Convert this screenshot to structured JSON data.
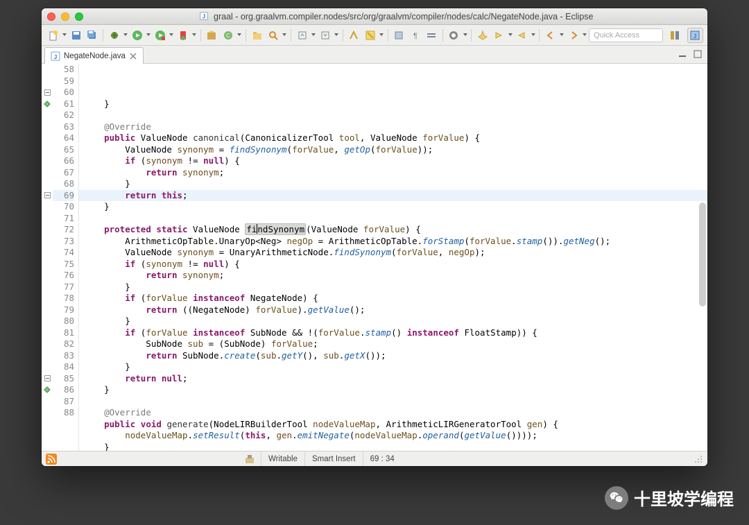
{
  "window": {
    "title": "graal - org.graalvm.compiler.nodes/src/org/graalvm/compiler/nodes/calc/NegateNode.java - Eclipse"
  },
  "toolbar": {
    "quick_access_placeholder": "Quick Access"
  },
  "tab": {
    "label": "NegateNode.java"
  },
  "status": {
    "mode": "Writable",
    "insert": "Smart Insert",
    "pos": "69 : 34"
  },
  "code_lines": [
    {
      "n": 58,
      "mark": "",
      "html": "    }"
    },
    {
      "n": 59,
      "mark": "",
      "html": ""
    },
    {
      "n": 60,
      "mark": "fold",
      "html": "    <span class=\"tok-ann\">@Override</span>"
    },
    {
      "n": 61,
      "mark": "ovr",
      "html": "    <span class=\"tok-kw\">public</span> ValueNode <span class=\"tok-type\">canonical</span>(CanonicalizerTool <span class=\"tok-param\">tool</span>, ValueNode <span class=\"tok-param\">forValue</span>) {"
    },
    {
      "n": 62,
      "mark": "",
      "html": "        ValueNode <span class=\"tok-var\">synonym</span> = <span class=\"tok-method-si\">findSynonym</span>(<span class=\"tok-param\">forValue</span>, <span class=\"tok-method-i\">getOp</span>(<span class=\"tok-param\">forValue</span>));"
    },
    {
      "n": 63,
      "mark": "",
      "html": "        <span class=\"tok-kw\">if</span> (<span class=\"tok-var\">synonym</span> != <span class=\"tok-kw\">null</span>) {"
    },
    {
      "n": 64,
      "mark": "",
      "html": "            <span class=\"tok-kw\">return</span> <span class=\"tok-var\">synonym</span>;"
    },
    {
      "n": 65,
      "mark": "",
      "html": "        }"
    },
    {
      "n": 66,
      "mark": "",
      "html": "        <span class=\"tok-kw\">return</span> <span class=\"tok-this\">this</span>;"
    },
    {
      "n": 67,
      "mark": "",
      "html": "    }"
    },
    {
      "n": 68,
      "mark": "",
      "html": ""
    },
    {
      "n": 69,
      "mark": "fold",
      "hl": true,
      "html": "    <span class=\"tok-kw\">protected</span> <span class=\"tok-kw\">static</span> ValueNode <span class=\"tok-highlight\">fi<span class=\"cursor\"></span>ndSynonym</span>(ValueNode <span class=\"tok-param\">forValue</span>) {"
    },
    {
      "n": 70,
      "mark": "",
      "html": "        ArithmeticOpTable.UnaryOp&lt;Neg&gt; <span class=\"tok-var\">negOp</span> = ArithmeticOpTable.<span class=\"tok-method-si\">forStamp</span>(<span class=\"tok-param\">forValue</span>.<span class=\"tok-method-i\">stamp</span>()).<span class=\"tok-method-i\">getNeg</span>();"
    },
    {
      "n": 71,
      "mark": "",
      "html": "        ValueNode <span class=\"tok-var\">synonym</span> = UnaryArithmeticNode.<span class=\"tok-method-si\">findSynonym</span>(<span class=\"tok-param\">forValue</span>, <span class=\"tok-var\">negOp</span>);"
    },
    {
      "n": 72,
      "mark": "",
      "html": "        <span class=\"tok-kw\">if</span> (<span class=\"tok-var\">synonym</span> != <span class=\"tok-kw\">null</span>) {"
    },
    {
      "n": 73,
      "mark": "",
      "html": "            <span class=\"tok-kw\">return</span> <span class=\"tok-var\">synonym</span>;"
    },
    {
      "n": 74,
      "mark": "",
      "html": "        }"
    },
    {
      "n": 75,
      "mark": "",
      "html": "        <span class=\"tok-kw\">if</span> (<span class=\"tok-param\">forValue</span> <span class=\"tok-kw\">instanceof</span> NegateNode) {"
    },
    {
      "n": 76,
      "mark": "",
      "html": "            <span class=\"tok-kw\">return</span> ((NegateNode) <span class=\"tok-param\">forValue</span>).<span class=\"tok-method-i\">getValue</span>();"
    },
    {
      "n": 77,
      "mark": "",
      "html": "        }"
    },
    {
      "n": 78,
      "mark": "",
      "html": "        <span class=\"tok-kw\">if</span> (<span class=\"tok-param\">forValue</span> <span class=\"tok-kw\">instanceof</span> SubNode &amp;&amp; !(<span class=\"tok-param\">forValue</span>.<span class=\"tok-method-i\">stamp</span>() <span class=\"tok-kw\">instanceof</span> FloatStamp)) {"
    },
    {
      "n": 79,
      "mark": "",
      "html": "            SubNode <span class=\"tok-var\">sub</span> = (SubNode) <span class=\"tok-param\">forValue</span>;"
    },
    {
      "n": 80,
      "mark": "",
      "html": "            <span class=\"tok-kw\">return</span> SubNode.<span class=\"tok-method-si\">create</span>(<span class=\"tok-var\">sub</span>.<span class=\"tok-method-i\">getY</span>(), <span class=\"tok-var\">sub</span>.<span class=\"tok-method-i\">getX</span>());"
    },
    {
      "n": 81,
      "mark": "",
      "html": "        }"
    },
    {
      "n": 82,
      "mark": "",
      "html": "        <span class=\"tok-kw\">return</span> <span class=\"tok-kw\">null</span>;"
    },
    {
      "n": 83,
      "mark": "",
      "html": "    }"
    },
    {
      "n": 84,
      "mark": "",
      "html": ""
    },
    {
      "n": 85,
      "mark": "fold",
      "html": "    <span class=\"tok-ann\">@Override</span>"
    },
    {
      "n": 86,
      "mark": "ovr",
      "html": "    <span class=\"tok-kw\">public</span> <span class=\"tok-kw\">void</span> <span class=\"tok-type\">generate</span>(NodeLIRBuilderTool <span class=\"tok-param\">nodeValueMap</span>, ArithmeticLIRGeneratorTool <span class=\"tok-param\">gen</span>) {"
    },
    {
      "n": 87,
      "mark": "",
      "html": "        <span class=\"tok-param\">nodeValueMap</span>.<span class=\"tok-method-i\">setResult</span>(<span class=\"tok-this\">this</span>, <span class=\"tok-param\">gen</span>.<span class=\"tok-method-i\">emitNegate</span>(<span class=\"tok-param\">nodeValueMap</span>.<span class=\"tok-method-i\">operand</span>(<span class=\"tok-method-i\">getValue</span>())));"
    },
    {
      "n": 88,
      "mark": "",
      "html": "    }"
    }
  ],
  "watermark": "十里坡学编程"
}
